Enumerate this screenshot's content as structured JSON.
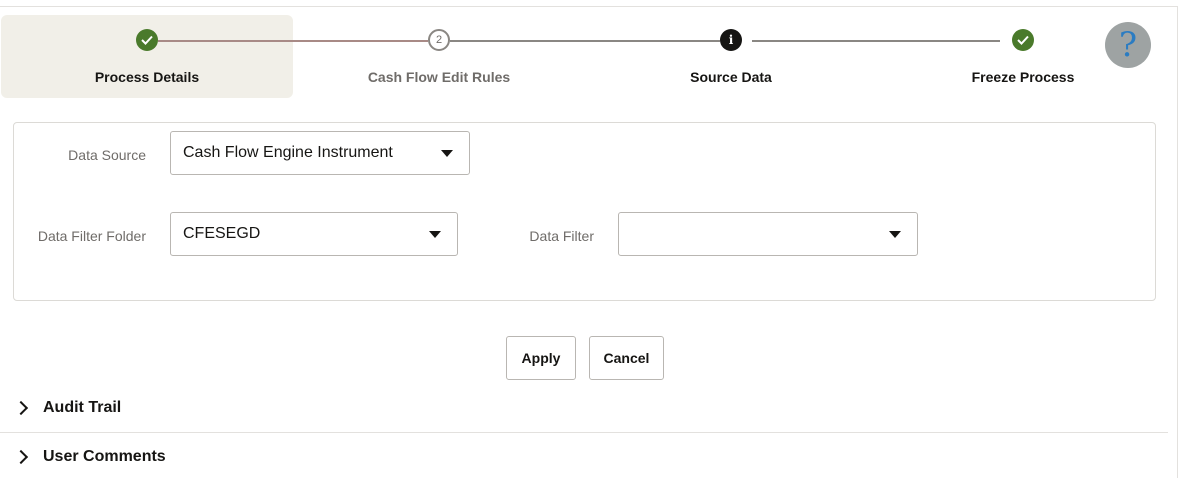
{
  "train": {
    "steps": [
      {
        "label": "Process Details",
        "state": "complete",
        "icon": "check-icon"
      },
      {
        "label": "Cash Flow Edit Rules",
        "state": "pending",
        "number": "2"
      },
      {
        "label": "Source Data",
        "state": "current",
        "icon": "info-icon",
        "glyph": "i"
      },
      {
        "label": "Freeze Process",
        "state": "complete",
        "icon": "check-icon"
      }
    ],
    "help_glyph": "?"
  },
  "form": {
    "data_source": {
      "label": "Data Source",
      "value": "Cash Flow Engine Instrument"
    },
    "data_filter_folder": {
      "label": "Data Filter Folder",
      "value": "CFESEGD"
    },
    "data_filter": {
      "label": "Data Filter",
      "value": ""
    }
  },
  "actions": {
    "apply": "Apply",
    "cancel": "Cancel"
  },
  "sections": {
    "audit_trail": "Audit Trail",
    "user_comments": "User Comments"
  },
  "colors": {
    "complete": "#4a7a2b",
    "current": "#161513",
    "selected_bg": "#f1efe8",
    "help_bg": "#9ea3a3",
    "help_fg": "#2b7cc2"
  }
}
